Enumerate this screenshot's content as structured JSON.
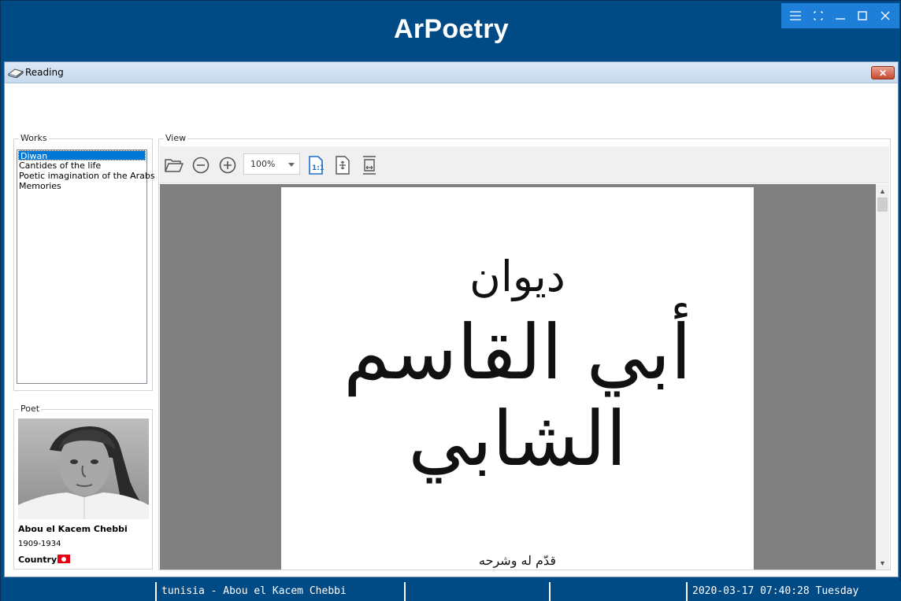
{
  "app": {
    "title": "ArPoetry",
    "accent_color": "#004a86",
    "controls_color": "#1e7fd9"
  },
  "window_controls": [
    "menu-icon",
    "fullscreen-icon",
    "minimize-icon",
    "maximize-icon",
    "close-icon"
  ],
  "reading_window": {
    "title": "Reading",
    "close_label": "✕"
  },
  "works": {
    "group_label": "Works",
    "items": [
      {
        "label": "Diwan",
        "selected": true
      },
      {
        "label": "Cantides of the life",
        "selected": false
      },
      {
        "label": "Poetic imagination of the Arabs",
        "selected": false
      },
      {
        "label": "Memories",
        "selected": false
      }
    ]
  },
  "poet": {
    "group_label": "Poet",
    "name": "Abou el Kacem Chebbi",
    "years": "1909-1934",
    "country_label": "Country",
    "flag": "tunisia-flag"
  },
  "view": {
    "group_label": "View",
    "zoom": "100%",
    "toolbar_icons": [
      "open-folder-icon",
      "zoom-out-icon",
      "zoom-in-icon",
      "fit-page-icon",
      "fit-width-icon",
      "actual-size-icon"
    ],
    "page": {
      "title_line_1": "ديوان",
      "title_line_2": "أبي القاسم الشابي",
      "caption": "قدّم له وشرحه"
    }
  },
  "status_bar": {
    "location": "tunisia - Abou el Kacem Chebbi",
    "cell_2": "",
    "cell_3": "",
    "datetime": "2020-03-17 07:40:28 Tuesday"
  }
}
